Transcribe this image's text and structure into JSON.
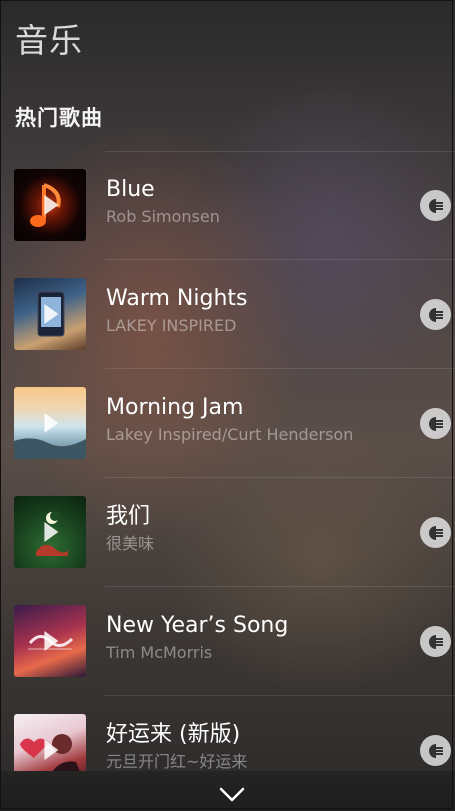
{
  "header": {
    "title": "音乐",
    "section_title": "热门歌曲"
  },
  "songs": [
    {
      "title": "Blue",
      "artist": "Rob Simonsen",
      "cover_icon": "play-icon"
    },
    {
      "title": "Warm Nights",
      "artist": "LAKEY INSPIRED",
      "cover_icon": "play-icon"
    },
    {
      "title": "Morning Jam",
      "artist": "Lakey Inspired/Curt Henderson",
      "cover_icon": "play-icon"
    },
    {
      "title": "我们",
      "artist": "很美味",
      "cover_icon": "play-icon"
    },
    {
      "title": "New Year’s Song",
      "artist": "Tim McMorris",
      "cover_icon": "play-icon"
    },
    {
      "title": "好运来 (新版)",
      "artist": "元旦开门红~好运来",
      "cover_icon": "play-icon"
    }
  ],
  "more_icon": "more-options-icon",
  "footer": {
    "icon": "chevron-down-icon"
  },
  "colors": {
    "more_button_bg": "#dcdcdc",
    "artist_text": "#8a8a8a",
    "title_text": "#ffffff"
  }
}
